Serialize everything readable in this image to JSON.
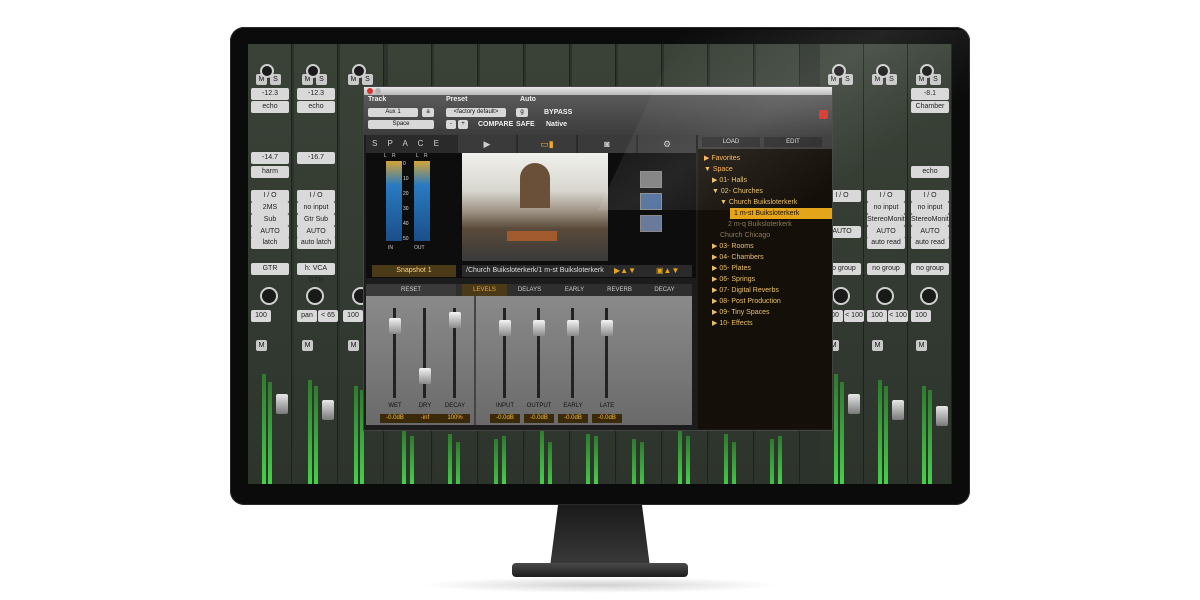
{
  "mixer": {
    "left_strips": [
      {
        "name": "echo",
        "meter": "-12.3",
        "insert": "harm",
        "meter2": "-14.7",
        "io": "I / O",
        "input": "2MS",
        "bus": "Sub",
        "auto": "AUTO",
        "mode": "latch",
        "track": "GTR",
        "pan": "100",
        "pan2": ""
      },
      {
        "name": "echo",
        "meter": "-12.3",
        "insert": "",
        "meter2": "-16.7",
        "io": "I / O",
        "input": "no input",
        "bus": "Gtr Sub",
        "auto": "AUTO",
        "mode": "auto latch",
        "track": "h: VCA GTR",
        "pan": "pan",
        "pan2": "< 65"
      },
      {
        "name": "",
        "meter": "",
        "insert": "",
        "meter2": "",
        "io": "",
        "input": "",
        "bus": "",
        "auto": "",
        "mode": "",
        "track": "",
        "pan": "100",
        "pan2": ""
      }
    ],
    "right_strips": [
      {
        "name": "",
        "meter": "",
        "insert": "",
        "meter2": "",
        "io": "I / O",
        "input": "",
        "bus": "",
        "auto": "AUTO",
        "mode": "",
        "track": "no group",
        "pan": "100",
        "pan2": "< 100"
      },
      {
        "name": "",
        "meter": "",
        "insert": "",
        "meter2": "",
        "io": "I / O",
        "input": "no input",
        "bus": "StereoMonitr",
        "auto": "AUTO",
        "mode": "auto read",
        "track": "no group",
        "pan": "100",
        "pan2": "< 100"
      },
      {
        "name": "Chamber",
        "meter": "-8.1",
        "insert": "echo",
        "meter2": "",
        "io": "I / O",
        "input": "no input",
        "bus": "StereoMonitr",
        "auto": "AUTO",
        "mode": "auto read",
        "track": "no group",
        "pan": "100",
        "pan2": ""
      }
    ],
    "mute_label": "M",
    "solo_label": "S"
  },
  "plugin": {
    "header": {
      "track_label": "Track",
      "preset_label": "Preset",
      "auto_label": "Auto",
      "track_value": "Aux 1",
      "preset_value": "<factory default>",
      "space_value": "Space",
      "compare": "COMPARE",
      "safe": "SAFE",
      "native": "Native",
      "bypass": "BYPASS",
      "misc": "+",
      "minus": "-",
      "track_suffix": "a",
      "bypass_btn": "g"
    },
    "brand": "S P A C E",
    "snapshot": "Snapshot 1",
    "path": "/Church Buiksloterkerk/1 m-st Buiksloterkerk",
    "meter_labels": {
      "l": "L",
      "r": "R",
      "in": "IN",
      "out": "OUT"
    },
    "meter_scale": [
      "0",
      "10",
      "20",
      "30",
      "40",
      "50"
    ],
    "subtabs": {
      "reset": "RESET",
      "levels": "LEVELS",
      "delays": "DELAYS",
      "early": "EARLY",
      "reverb": "REVERB",
      "decay": "DECAY"
    },
    "faders": [
      {
        "label": "WET",
        "value": "-0.0dB",
        "level": 0.88
      },
      {
        "label": "DRY",
        "value": "-inf",
        "level": 0.25
      },
      {
        "label": "DECAY",
        "value": "100%",
        "level": 0.95
      },
      {
        "label": "INPUT",
        "value": "-0.0dB",
        "level": 0.85
      },
      {
        "label": "OUTPUT",
        "value": "-0.0dB",
        "level": 0.85
      },
      {
        "label": "EARLY",
        "value": "-0.0dB",
        "level": 0.85
      },
      {
        "label": "LATE",
        "value": "-0.0dB",
        "level": 0.85
      }
    ],
    "browser": {
      "load": "LOAD",
      "edit": "EDIT",
      "items": [
        {
          "text": "▶ Favorites",
          "indent": 0,
          "style": "top"
        },
        {
          "text": "▼ Space",
          "indent": 0,
          "style": "top"
        },
        {
          "text": "▶ 01- Halls",
          "indent": 1,
          "style": ""
        },
        {
          "text": "▼ 02- Churches",
          "indent": 1,
          "style": ""
        },
        {
          "text": "▼ Church Buiksloterkerk",
          "indent": 2,
          "style": ""
        },
        {
          "text": "1 m-st Buiksloterkerk",
          "indent": 3,
          "style": "sel"
        },
        {
          "text": "2 m-q Buiksloterkerk",
          "indent": 3,
          "style": "dim"
        },
        {
          "text": "Church Chicago",
          "indent": 2,
          "style": "dim"
        },
        {
          "text": "▶ 03- Rooms",
          "indent": 1,
          "style": ""
        },
        {
          "text": "▶ 04- Chambers",
          "indent": 1,
          "style": ""
        },
        {
          "text": "▶ 05- Plates",
          "indent": 1,
          "style": ""
        },
        {
          "text": "▶ 06- Springs",
          "indent": 1,
          "style": ""
        },
        {
          "text": "▶ 07- Digital Reverbs",
          "indent": 1,
          "style": ""
        },
        {
          "text": "▶ 08- Post Production",
          "indent": 1,
          "style": ""
        },
        {
          "text": "▶ 09- Tiny Spaces",
          "indent": 1,
          "style": ""
        },
        {
          "text": "▶ 10- Effects",
          "indent": 1,
          "style": ""
        }
      ]
    }
  },
  "colors": {
    "accent": "#e5a51a",
    "meter_green": "#46d04a"
  }
}
